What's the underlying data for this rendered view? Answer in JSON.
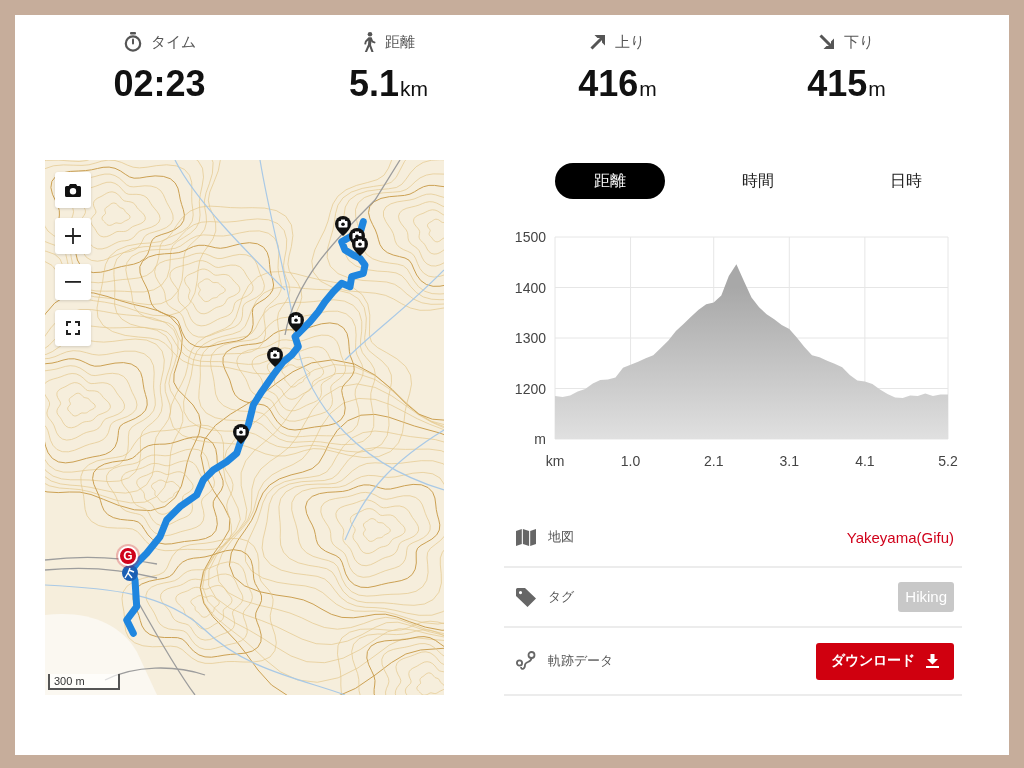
{
  "stats": [
    {
      "label": "タイム",
      "value": "02:23"
    },
    {
      "label": "距離",
      "value": "5.1",
      "unit": "km"
    },
    {
      "label": "上り",
      "value": "416",
      "unit": "m"
    },
    {
      "label": "下り",
      "value": "415",
      "unit": "m"
    }
  ],
  "map": {
    "goal_marker": "G",
    "scale": "300 m"
  },
  "chart_tabs": [
    {
      "label": "距離",
      "selected": true
    },
    {
      "label": "時間",
      "selected": false
    },
    {
      "label": "日時",
      "selected": false
    }
  ],
  "elevation_chart": {
    "chart_data": {
      "type": "area",
      "grid": true,
      "x": [
        0.0,
        0.1,
        0.2,
        0.3,
        0.4,
        0.5,
        0.6,
        0.7,
        0.8,
        0.9,
        1.0,
        1.1,
        1.2,
        1.3,
        1.4,
        1.5,
        1.6,
        1.7,
        1.8,
        1.9,
        2.0,
        2.1,
        2.2,
        2.3,
        2.4,
        2.5,
        2.6,
        2.7,
        2.8,
        2.9,
        3.0,
        3.1,
        3.2,
        3.3,
        3.4,
        3.5,
        3.6,
        3.7,
        3.8,
        3.9,
        4.0,
        4.1,
        4.2,
        4.3,
        4.4,
        4.5,
        4.6,
        4.7,
        4.8,
        4.9,
        5.0,
        5.1,
        5.2
      ],
      "values": [
        1185,
        1183,
        1186,
        1194,
        1199,
        1210,
        1217,
        1218,
        1222,
        1241,
        1247,
        1253,
        1260,
        1266,
        1280,
        1295,
        1314,
        1328,
        1342,
        1356,
        1367,
        1370,
        1384,
        1423,
        1446,
        1413,
        1380,
        1361,
        1347,
        1337,
        1326,
        1318,
        1301,
        1282,
        1266,
        1262,
        1255,
        1249,
        1242,
        1227,
        1216,
        1214,
        1209,
        1198,
        1189,
        1182,
        1181,
        1186,
        1185,
        1190,
        1185,
        1188,
        1188
      ],
      "xlim": [
        0,
        5.2
      ],
      "ylim": [
        1100,
        1500
      ],
      "xticks": [
        {
          "value": 0,
          "label": "km"
        },
        {
          "value": 1.0,
          "label": "1.0"
        },
        2.1,
        3.1,
        4.1,
        5.2
      ],
      "yticks": [
        {
          "value": 1100,
          "label": "m"
        },
        1200,
        1300,
        1400,
        1500
      ]
    }
  },
  "details": [
    {
      "kind": "link",
      "label": "地図",
      "value": "Yakeyama(Gifu)"
    },
    {
      "kind": "tag",
      "label": "タグ",
      "value": "Hiking"
    },
    {
      "kind": "button",
      "label": "軌跡データ",
      "value": "ダウンロード"
    }
  ]
}
